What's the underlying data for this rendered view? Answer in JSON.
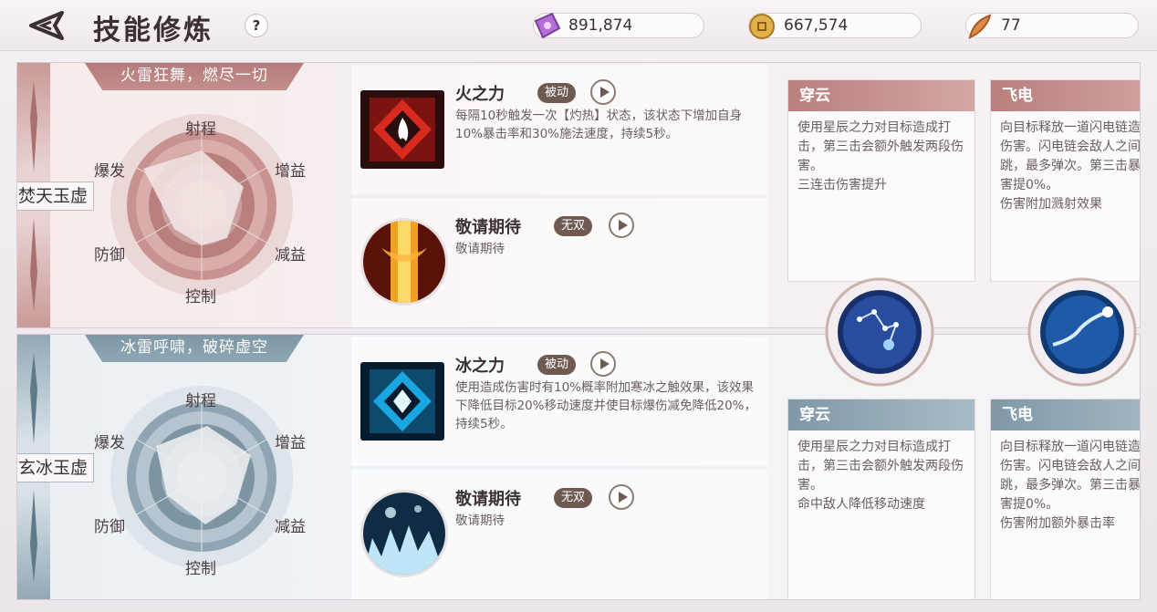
{
  "header": {
    "title": "技能修炼",
    "help_label": "?"
  },
  "resources": [
    {
      "icon": "purple-ticket-icon",
      "value": "891,874"
    },
    {
      "icon": "gold-coin-icon",
      "value": "667,574"
    },
    {
      "icon": "feather-token-icon",
      "value": "77"
    }
  ],
  "colors": {
    "fire_accent": "#b97f7d",
    "ice_accent": "#7f98a7",
    "badge": "#6f5a52"
  },
  "radar_labels": {
    "top": "射程",
    "upper_left": "爆发",
    "upper_right": "增益",
    "lower_left": "防御",
    "lower_right": "减益",
    "bottom": "控制"
  },
  "fire": {
    "motto": "火雷狂舞，燃尽一切",
    "class_name": "焚天玉虚",
    "skills": [
      {
        "name": "火之力",
        "badge": "被动",
        "desc": "每隔10秒触发一次【灼热】状态，该状态下增加自身10%暴击率和30%施法速度，持续5秒。"
      },
      {
        "name": "敬请期待",
        "badge": "无双",
        "desc": "敬请期待"
      }
    ],
    "cards": [
      {
        "title": "穿云",
        "text": "使用星辰之力对目标造成打击，第三击会额外触发两段伤害。\n三连击伤害提升"
      },
      {
        "title": "飞电",
        "text": "向目标释放一道闪电链造成雷伤害。闪电链会敌人之间弹跳，最多弹次。第三击暴击伤害提0%。\n伤害附加溅射效果"
      }
    ]
  },
  "ice": {
    "motto": "冰雷呼啸，破碎虚空",
    "class_name": "玄冰玉虚",
    "skills": [
      {
        "name": "冰之力",
        "badge": "被动",
        "desc": "使用造成伤害时有10%概率附加寒冰之触效果，该效果下降低目标20%移动速度并使目标爆伤减免降低20%，持续5秒。"
      },
      {
        "name": "敬请期待",
        "badge": "无双",
        "desc": "敬请期待"
      }
    ],
    "cards": [
      {
        "title": "穿云",
        "text": "使用星辰之力对目标造成打击，第三击会额外触发两段伤害。\n命中敌人降低移动速度"
      },
      {
        "title": "飞电",
        "text": "向目标释放一道闪电链造成雷伤害。闪电链会敌人之间弹跳，最多弹次。第三击暴击伤害提0%。\n伤害附加额外暴击率"
      }
    ]
  }
}
